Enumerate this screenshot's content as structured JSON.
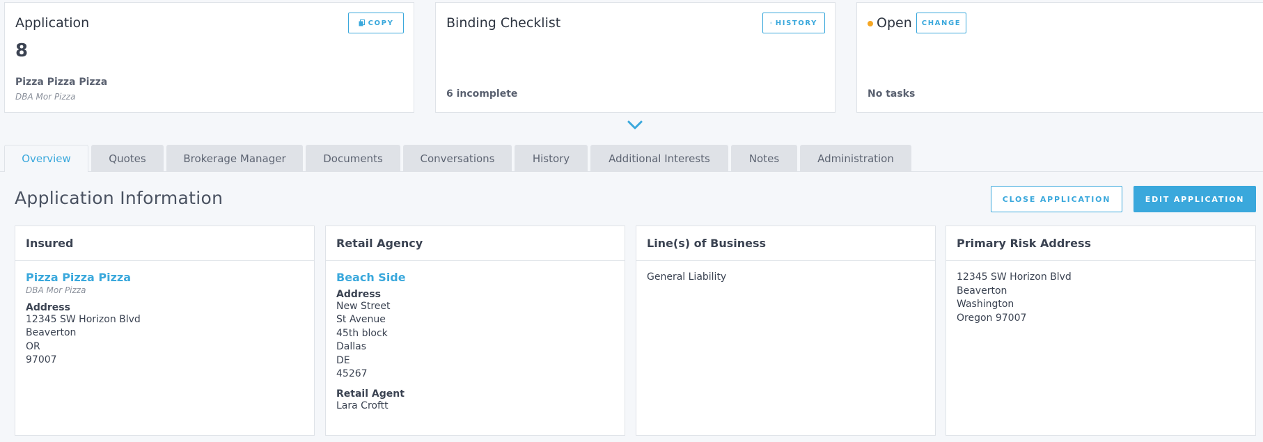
{
  "summary": {
    "application": {
      "title": "Application",
      "copy_label": "COPY",
      "number": "8",
      "insured_name": "Pizza Pizza Pizza",
      "dba": "DBA Mor Pizza"
    },
    "checklist": {
      "title": "Binding Checklist",
      "history_label": "HISTORY",
      "status": "6 incomplete"
    },
    "status": {
      "title": "Open",
      "change_label": "CHANGE",
      "tasks": "No tasks"
    }
  },
  "tabs": [
    {
      "label": "Overview",
      "active": true
    },
    {
      "label": "Quotes"
    },
    {
      "label": "Brokerage Manager"
    },
    {
      "label": "Documents"
    },
    {
      "label": "Conversations"
    },
    {
      "label": "History"
    },
    {
      "label": "Additional Interests"
    },
    {
      "label": "Notes"
    },
    {
      "label": "Administration"
    }
  ],
  "section": {
    "title": "Application Information",
    "close_label": "CLOSE APPLICATION",
    "edit_label": "EDIT APPLICATION"
  },
  "insured": {
    "heading": "Insured",
    "name": "Pizza Pizza Pizza",
    "dba": "DBA Mor Pizza",
    "address_label": "Address",
    "address_lines": [
      "12345 SW Horizon Blvd",
      "Beaverton",
      "OR",
      "97007"
    ]
  },
  "agency": {
    "heading": "Retail Agency",
    "name": "Beach Side",
    "address_label": "Address",
    "address_lines": [
      "New Street",
      "St Avenue",
      "45th block",
      "Dallas",
      "DE",
      "45267"
    ],
    "agent_label": "Retail Agent",
    "agent_name": "Lara Croftt"
  },
  "business": {
    "heading": "Line(s) of Business",
    "line": "General Liability"
  },
  "risk": {
    "heading": "Primary Risk Address",
    "address_lines": [
      "12345 SW Horizon Blvd",
      "Beaverton",
      "Washington",
      "Oregon 97007"
    ]
  },
  "colors": {
    "accent": "#3aa8dc",
    "status_dot": "#f5a623",
    "border": "#dfe3e8",
    "background": "#f5f7fa"
  }
}
